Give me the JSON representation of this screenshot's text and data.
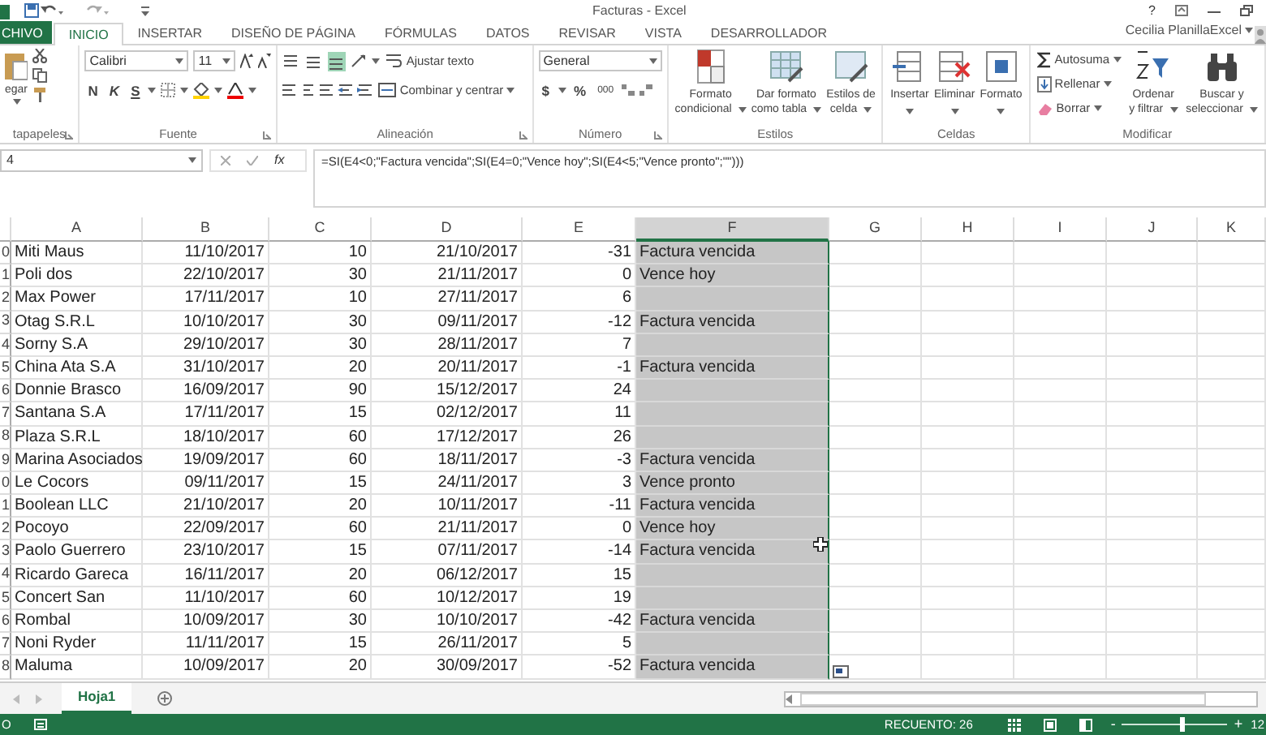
{
  "window": {
    "title": "Facturas - Excel",
    "help": "?"
  },
  "ribbon_tabs": [
    {
      "label": "CHIVO",
      "kind": "file",
      "selected": false
    },
    {
      "label": "INICIO",
      "kind": "tab",
      "selected": true
    },
    {
      "label": "INSERTAR",
      "kind": "tab",
      "selected": false
    },
    {
      "label": "DISEÑO DE PÁGINA",
      "kind": "tab",
      "selected": false
    },
    {
      "label": "FÓRMULAS",
      "kind": "tab",
      "selected": false
    },
    {
      "label": "DATOS",
      "kind": "tab",
      "selected": false
    },
    {
      "label": "REVISAR",
      "kind": "tab",
      "selected": false
    },
    {
      "label": "VISTA",
      "kind": "tab",
      "selected": false
    },
    {
      "label": "DESARROLLADOR",
      "kind": "tab",
      "selected": false
    }
  ],
  "account": {
    "name": "Cecilia PlanillaExcel"
  },
  "ribbon_groups": [
    {
      "kind": "clipboard",
      "label": "tapapeles",
      "paste": "egar"
    },
    {
      "kind": "font",
      "label": "Fuente",
      "font": "Calibri",
      "size": "11",
      "bold": "N",
      "italic": "K",
      "underline": "S"
    },
    {
      "kind": "alignment",
      "label": "Alineación",
      "wrap": "Ajustar texto",
      "merge": "Combinar y centrar",
      "valign": [
        {
          "on": false
        },
        {
          "on": false
        },
        {
          "on": true
        }
      ]
    },
    {
      "kind": "number",
      "label": "Número",
      "format": "General",
      "currency": "$",
      "percent": "%",
      "thousands": "000"
    },
    {
      "kind": "styles",
      "label": "Estilos",
      "buttons": [
        [
          "Formato",
          "condicional"
        ],
        [
          "Dar formato",
          "como tabla"
        ],
        [
          "Estilos de",
          "celda"
        ]
      ]
    },
    {
      "kind": "cells",
      "label": "Celdas",
      "buttons": [
        "Insertar",
        "Eliminar",
        "Formato"
      ]
    },
    {
      "kind": "editing",
      "label": "Modificar",
      "small": [
        "Autosuma",
        "Rellenar",
        "Borrar"
      ],
      "buttons": [
        [
          "Ordenar",
          "y filtrar"
        ],
        [
          "Buscar y",
          "seleccionar"
        ]
      ]
    }
  ],
  "formula_bar": {
    "name_box": "4",
    "fx": "fx",
    "formula": "=SI(E4<0;\"Factura vencida\";SI(E4=0;\"Vence hoy\";SI(E4<5;\"Vence pronto\";\"\")))"
  },
  "columns": [
    {
      "label": "A",
      "selected": false
    },
    {
      "label": "B",
      "selected": false
    },
    {
      "label": "C",
      "selected": false
    },
    {
      "label": "D",
      "selected": false
    },
    {
      "label": "E",
      "selected": false
    },
    {
      "label": "F",
      "selected": true
    },
    {
      "label": "G",
      "selected": false
    },
    {
      "label": "H",
      "selected": false
    },
    {
      "label": "I",
      "selected": false
    },
    {
      "label": "J",
      "selected": false
    },
    {
      "label": "K",
      "selected": false
    }
  ],
  "rows": [
    {
      "number": "0",
      "cells": [
        "Miti Maus",
        "11/10/2017",
        "10",
        "21/10/2017",
        "-31",
        "Factura vencida"
      ]
    },
    {
      "number": "1",
      "cells": [
        "Poli dos",
        "22/10/2017",
        "30",
        "21/11/2017",
        "0",
        "Vence hoy"
      ]
    },
    {
      "number": "2",
      "cells": [
        "Max Power",
        "17/11/2017",
        "10",
        "27/11/2017",
        "6"
      ]
    },
    {
      "number": "3",
      "cells": [
        "Otag S.R.L",
        "10/10/2017",
        "30",
        "09/11/2017",
        "-12",
        "Factura vencida"
      ]
    },
    {
      "number": "4",
      "cells": [
        "Sorny S.A",
        "29/10/2017",
        "30",
        "28/11/2017",
        "7"
      ]
    },
    {
      "number": "5",
      "cells": [
        "China Ata S.A",
        "31/10/2017",
        "20",
        "20/11/2017",
        "-1",
        "Factura vencida"
      ]
    },
    {
      "number": "6",
      "cells": [
        "Donnie Brasco",
        "16/09/2017",
        "90",
        "15/12/2017",
        "24"
      ]
    },
    {
      "number": "7",
      "cells": [
        "Santana S.A",
        "17/11/2017",
        "15",
        "02/12/2017",
        "11"
      ]
    },
    {
      "number": "8",
      "cells": [
        "Plaza S.R.L",
        "18/10/2017",
        "60",
        "17/12/2017",
        "26"
      ]
    },
    {
      "number": "9",
      "cells": [
        "Marina Asociados",
        "19/09/2017",
        "60",
        "18/11/2017",
        "-3",
        "Factura vencida"
      ]
    },
    {
      "number": "0",
      "cells": [
        "Le Cocors",
        "09/11/2017",
        "15",
        "24/11/2017",
        "3",
        "Vence pronto"
      ]
    },
    {
      "number": "1",
      "cells": [
        "Boolean LLC",
        "21/10/2017",
        "20",
        "10/11/2017",
        "-11",
        "Factura vencida"
      ]
    },
    {
      "number": "2",
      "cells": [
        "Pocoyo",
        "22/09/2017",
        "60",
        "21/11/2017",
        "0",
        "Vence hoy"
      ]
    },
    {
      "number": "3",
      "cells": [
        "Paolo Guerrero",
        "23/10/2017",
        "15",
        "07/11/2017",
        "-14",
        "Factura vencida"
      ]
    },
    {
      "number": "4",
      "cells": [
        "Ricardo Gareca",
        "16/11/2017",
        "20",
        "06/12/2017",
        "15"
      ]
    },
    {
      "number": "5",
      "cells": [
        "Concert San",
        "11/10/2017",
        "60",
        "10/12/2017",
        "19"
      ]
    },
    {
      "number": "6",
      "cells": [
        "Rombal",
        "10/09/2017",
        "30",
        "10/10/2017",
        "-42",
        "Factura vencida"
      ]
    },
    {
      "number": "7",
      "cells": [
        "Noni Ryder",
        "11/11/2017",
        "15",
        "26/11/2017",
        "5"
      ]
    },
    {
      "number": "8",
      "cells": [
        "Maluma",
        "10/09/2017",
        "20",
        "30/09/2017",
        "-52",
        "Factura vencida"
      ]
    }
  ],
  "sheet_tabs": [
    {
      "label": "Hoja1",
      "selected": true
    }
  ],
  "status_bar": {
    "mode": "O",
    "count": "RECUENTO: 26",
    "zoom_out": "-",
    "zoom_in": "+",
    "zoom": "12",
    "zoom_slider": {
      "level": 0.55
    }
  }
}
